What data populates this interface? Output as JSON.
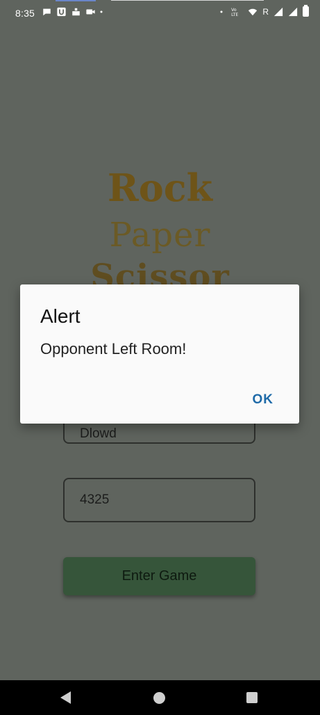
{
  "status_bar": {
    "time": "8:35",
    "left_icons": [
      "message-icon",
      "u-app-icon",
      "notification-icon",
      "video-icon",
      "dot-icon"
    ],
    "right_icons": [
      "dot-icon",
      "volte-icon",
      "wifi-icon",
      "roaming-icon",
      "signal-icon",
      "signal-icon",
      "battery-icon"
    ],
    "roaming_label": "R"
  },
  "app": {
    "title_line1": "Rock",
    "title_line2": "Paper",
    "title_line3": "Scissor",
    "name_field_value": "Dlowd",
    "room_field_value": "4325",
    "enter_button_label": "Enter Game"
  },
  "dialog": {
    "title": "Alert",
    "message": "Opponent Left Room!",
    "ok_label": "OK"
  },
  "colors": {
    "scrim_background": "#5f645e",
    "title_gold": "#6e5418",
    "button_green": "#36553a",
    "dialog_button_blue": "#1e6aa8"
  }
}
